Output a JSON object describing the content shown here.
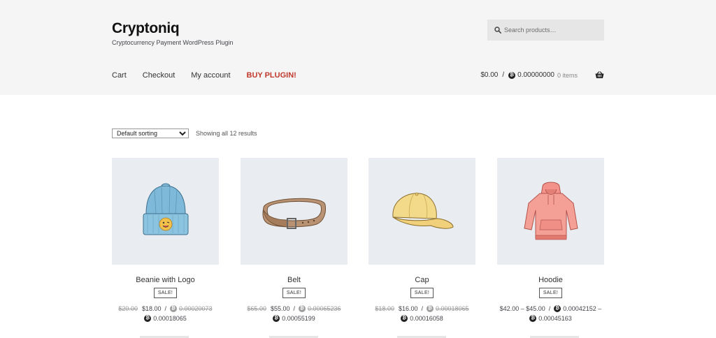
{
  "header": {
    "site_title": "Cryptoniq",
    "site_description": "Cryptocurrency Payment WordPress Plugin",
    "search_placeholder": "Search products…",
    "nav": [
      "Cart",
      "Checkout",
      "My account",
      "BUY PLUGIN!"
    ],
    "cart": {
      "price": "$0.00",
      "separator": "/",
      "crypto_price": "0.00000000",
      "items": "0 items"
    }
  },
  "toolbar": {
    "sort_selected": "Default sorting",
    "result_count": "Showing all 12 results"
  },
  "products": [
    {
      "title": "Beanie with Logo",
      "badge": "SALE!",
      "old_price": "$20.00",
      "price": "$18.00",
      "old_crypto": "0.00020073",
      "crypto": "0.00018065"
    },
    {
      "title": "Belt",
      "badge": "SALE!",
      "old_price": "$65.00",
      "price": "$55.00",
      "old_crypto": "0.00065236",
      "crypto": "0.00055199"
    },
    {
      "title": "Cap",
      "badge": "SALE!",
      "old_price": "$18.00",
      "price": "$16.00",
      "old_crypto": "0.00018065",
      "crypto": "0.00016058"
    },
    {
      "title": "Hoodie",
      "badge": "SALE!",
      "price_range": "$42.00 – $45.00",
      "crypto_range_start": "0.00042152 –",
      "crypto": "0.00045163"
    }
  ],
  "icons": {
    "search": "search-icon",
    "basket": "basket-icon",
    "currency": "bitcoin-coin-icon"
  },
  "colors": {
    "header_bg": "#f5f5f5",
    "buy_link": "#c0392b",
    "image_bg": "#e9edf2"
  }
}
